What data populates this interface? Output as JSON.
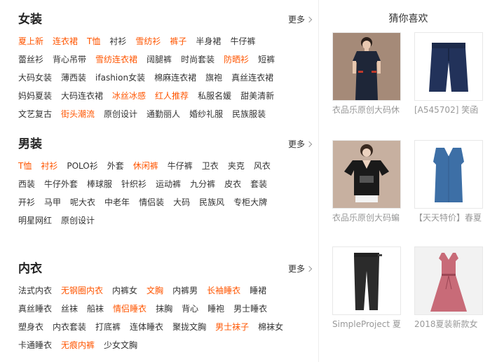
{
  "sections": [
    {
      "title": "女装",
      "more_label": "更多",
      "links": [
        {
          "text": "夏上新",
          "hot": true
        },
        {
          "text": "连衣裙",
          "hot": true
        },
        {
          "text": "T恤",
          "hot": true
        },
        {
          "text": "衬衫",
          "hot": false
        },
        {
          "text": "雪纺衫",
          "hot": true
        },
        {
          "text": "裤子",
          "hot": true
        },
        {
          "text": "半身裙",
          "hot": false
        },
        {
          "text": "牛仔裤",
          "hot": false
        },
        {
          "text": "蕾丝衫",
          "hot": false
        },
        {
          "text": "背心吊带",
          "hot": false
        },
        {
          "text": "雪纺连衣裙",
          "hot": true
        },
        {
          "text": "阔腿裤",
          "hot": false
        },
        {
          "text": "时尚套装",
          "hot": false
        },
        {
          "text": "防晒衫",
          "hot": true
        },
        {
          "text": "短裤",
          "hot": false
        },
        {
          "text": "大码女装",
          "hot": false
        },
        {
          "text": "薄西装",
          "hot": false
        },
        {
          "text": "ifashion女装",
          "hot": false
        },
        {
          "text": "棉麻连衣裙",
          "hot": false
        },
        {
          "text": "旗袍",
          "hot": false
        },
        {
          "text": "真丝连衣裙",
          "hot": false
        },
        {
          "text": "妈妈夏装",
          "hot": false
        },
        {
          "text": "大码连衣裙",
          "hot": false
        },
        {
          "text": "冰丝冰感",
          "hot": true
        },
        {
          "text": "红人推荐",
          "hot": true
        },
        {
          "text": "私服名媛",
          "hot": false
        },
        {
          "text": "甜美清新",
          "hot": false
        },
        {
          "text": "文艺复古",
          "hot": false
        },
        {
          "text": "街头潮流",
          "hot": true
        },
        {
          "text": "原创设计",
          "hot": false
        },
        {
          "text": "通勤丽人",
          "hot": false
        },
        {
          "text": "婚纱礼服",
          "hot": false
        },
        {
          "text": "民族服装",
          "hot": false
        }
      ]
    },
    {
      "title": "男装",
      "more_label": "更多",
      "links": [
        {
          "text": "T恤",
          "hot": true
        },
        {
          "text": "衬衫",
          "hot": true
        },
        {
          "text": "POLO衫",
          "hot": false
        },
        {
          "text": "外套",
          "hot": false
        },
        {
          "text": "休闲裤",
          "hot": true
        },
        {
          "text": "牛仔裤",
          "hot": false
        },
        {
          "text": "卫衣",
          "hot": false
        },
        {
          "text": "夹克",
          "hot": false
        },
        {
          "text": "风衣",
          "hot": false
        },
        {
          "text": "西装",
          "hot": false
        },
        {
          "text": "牛仔外套",
          "hot": false
        },
        {
          "text": "棒球服",
          "hot": false
        },
        {
          "text": "针织衫",
          "hot": false
        },
        {
          "text": "运动裤",
          "hot": false
        },
        {
          "text": "九分裤",
          "hot": false
        },
        {
          "text": "皮衣",
          "hot": false
        },
        {
          "text": "套装",
          "hot": false
        },
        {
          "text": "开衫",
          "hot": false
        },
        {
          "text": "马甲",
          "hot": false
        },
        {
          "text": "呢大衣",
          "hot": false
        },
        {
          "text": "中老年",
          "hot": false
        },
        {
          "text": "情侣装",
          "hot": false
        },
        {
          "text": "大码",
          "hot": false
        },
        {
          "text": "民族风",
          "hot": false
        },
        {
          "text": "专柜大牌",
          "hot": false
        },
        {
          "text": "明星网红",
          "hot": false
        },
        {
          "text": "原创设计",
          "hot": false
        }
      ]
    },
    {
      "title": "内衣",
      "more_label": "更多",
      "links": [
        {
          "text": "法式内衣",
          "hot": false
        },
        {
          "text": "无钢圈内衣",
          "hot": true
        },
        {
          "text": "内裤女",
          "hot": false
        },
        {
          "text": "文胸",
          "hot": true
        },
        {
          "text": "内裤男",
          "hot": false
        },
        {
          "text": "长袖睡衣",
          "hot": true
        },
        {
          "text": "睡裙",
          "hot": false
        },
        {
          "text": "真丝睡衣",
          "hot": false
        },
        {
          "text": "丝袜",
          "hot": false
        },
        {
          "text": "船袜",
          "hot": false
        },
        {
          "text": "情侣睡衣",
          "hot": true
        },
        {
          "text": "抹胸",
          "hot": false
        },
        {
          "text": "背心",
          "hot": false
        },
        {
          "text": "睡袍",
          "hot": false
        },
        {
          "text": "男士睡衣",
          "hot": false
        },
        {
          "text": "塑身衣",
          "hot": false
        },
        {
          "text": "内衣套装",
          "hot": false
        },
        {
          "text": "打底裤",
          "hot": false
        },
        {
          "text": "连体睡衣",
          "hot": false
        },
        {
          "text": "聚拢文胸",
          "hot": false
        },
        {
          "text": "男士袜子",
          "hot": true
        },
        {
          "text": "棉袜女",
          "hot": false
        },
        {
          "text": "卡通睡衣",
          "hot": false
        },
        {
          "text": "无痕内裤",
          "hot": true
        },
        {
          "text": "少女文胸",
          "hot": false
        }
      ]
    }
  ],
  "recommend": {
    "title": "猜你喜欢",
    "products": [
      {
        "title": "衣品乐原创大码休",
        "image": "navy-dress-image"
      },
      {
        "title": "[A545702] 笑函",
        "image": "navy-shorts-image"
      },
      {
        "title": "衣品乐原创大码蝙",
        "image": "black-tshirt-image"
      },
      {
        "title": "【天天特价】春夏",
        "image": "blue-top-image"
      },
      {
        "title": "SimpleProject 夏",
        "image": "black-pants-image"
      },
      {
        "title": "2018夏装新款女",
        "image": "pink-dress-image"
      }
    ]
  },
  "colors": {
    "hot_link": "#ff5500",
    "normal_link": "#333333",
    "product_title": "#999999"
  }
}
